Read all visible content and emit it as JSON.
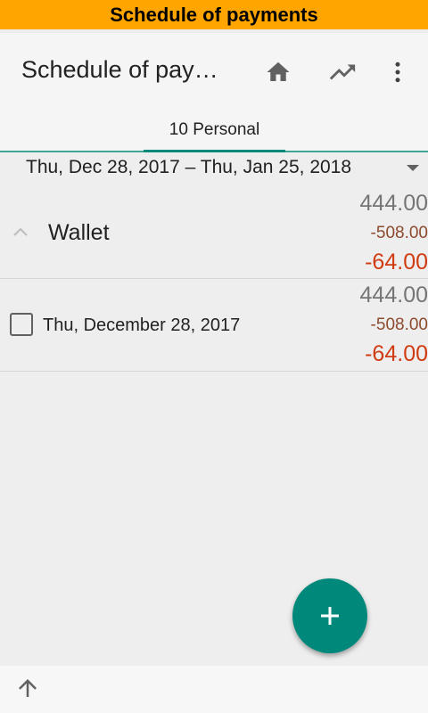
{
  "banner": {
    "title": "Schedule of payments"
  },
  "appbar": {
    "title": "Schedule of pay…",
    "actions": [
      "home-icon",
      "trending-up-icon",
      "more-vert-icon"
    ]
  },
  "tabs": [
    {
      "label": "10 Personal",
      "selected": true
    }
  ],
  "date_range": {
    "label": "Thu, Dec 28, 2017 – Thu, Jan 25, 2018"
  },
  "wallet": {
    "label": "Wallet",
    "amount_total": "444.00",
    "amount_out": "-508.00",
    "amount_net": "-64.00"
  },
  "entries": [
    {
      "date": "Thu, December 28, 2017",
      "amount_total": "444.00",
      "amount_out": "-508.00",
      "amount_net": "-64.00",
      "checked": false
    }
  ],
  "colors": {
    "banner": "#ffa500",
    "accent": "#00897b",
    "negative": "#d13b12",
    "out": "#8d4a2d"
  },
  "fab": {
    "icon": "plus-icon"
  },
  "bottom": {
    "icon": "arrow-up-icon"
  }
}
